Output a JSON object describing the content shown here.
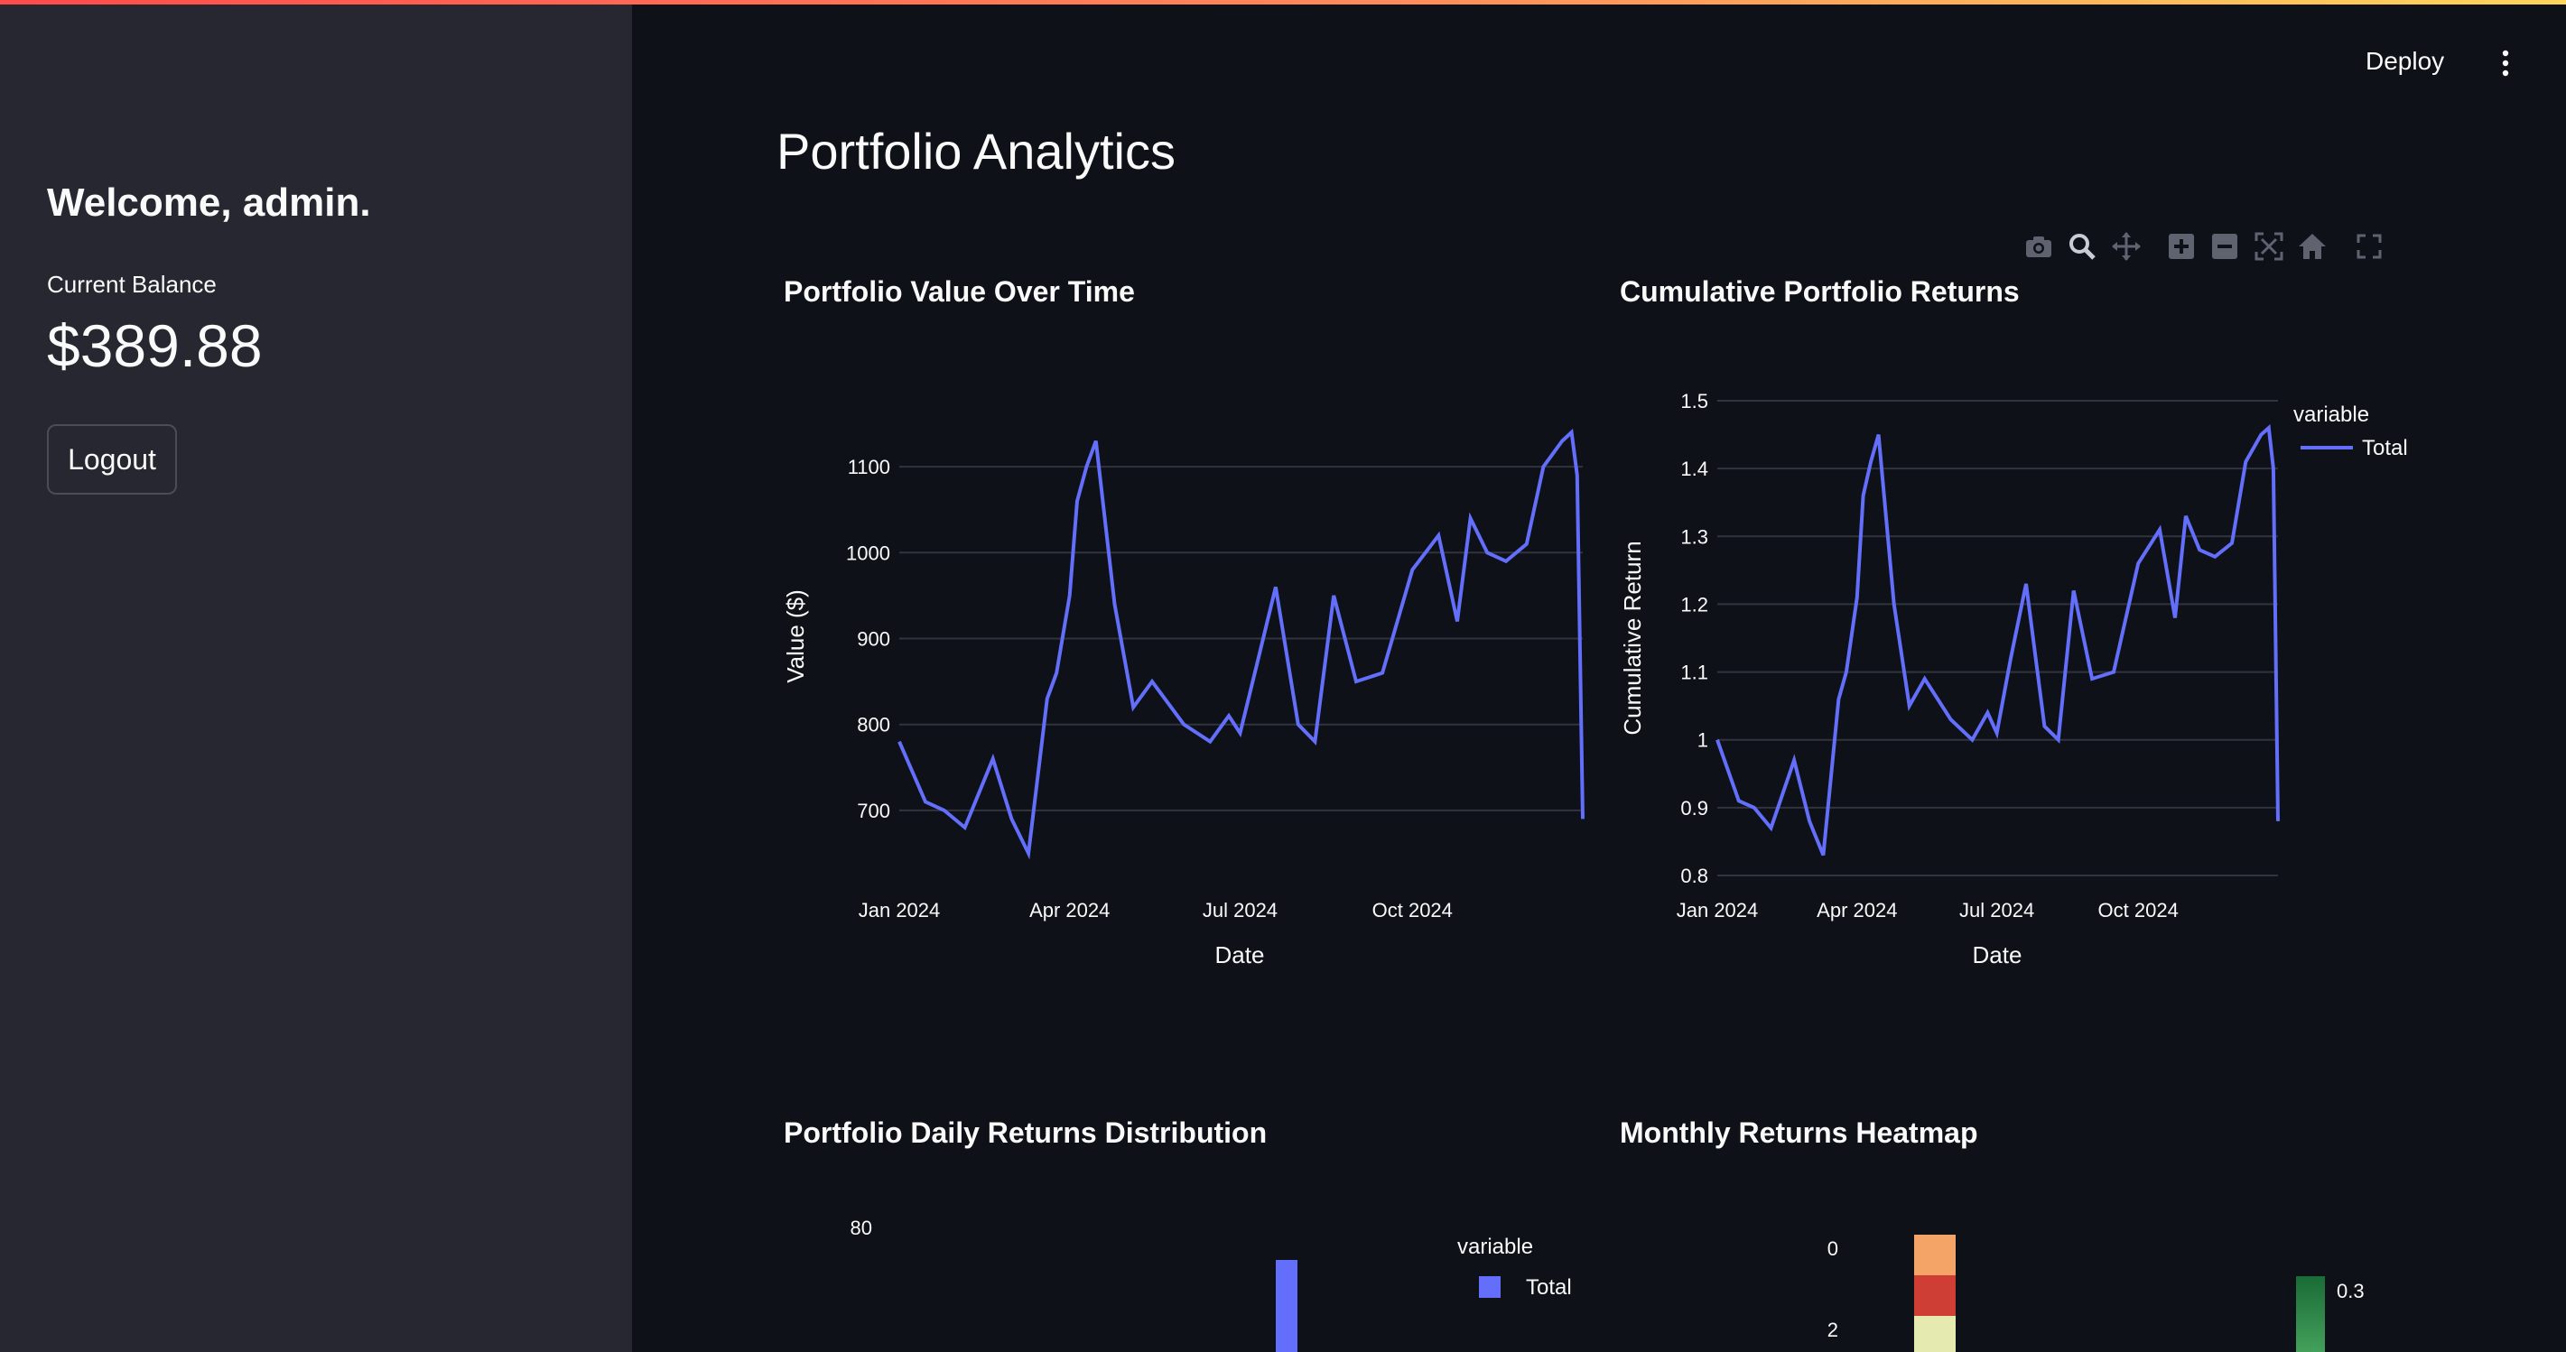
{
  "sidebar": {
    "welcome": "Welcome, admin.",
    "balance_label": "Current Balance",
    "balance_value": "$389.88",
    "logout_label": "Logout"
  },
  "header": {
    "deploy_label": "Deploy",
    "menu_icon": "vertical-ellipsis-icon"
  },
  "page": {
    "title": "Portfolio Analytics"
  },
  "modebar": {
    "icons": [
      "camera-icon",
      "zoom-icon",
      "pan-icon",
      "zoom-in-icon",
      "zoom-out-icon",
      "autoscale-icon",
      "reset-axes-icon",
      "fullscreen-icon"
    ]
  },
  "colors": {
    "accent": "#636efa",
    "background": "#0e1117",
    "sidebar": "#262730",
    "grid": "#31333f"
  },
  "charts": {
    "value": {
      "title": "Portfolio Value Over Time"
    },
    "returns": {
      "title": "Cumulative Portfolio Returns"
    },
    "distribution": {
      "title": "Portfolio Daily Returns Distribution"
    },
    "heatmap": {
      "title": "Monthly Returns Heatmap"
    }
  },
  "chart_data": [
    {
      "type": "line",
      "title": "Portfolio Value Over Time",
      "xlabel": "Date",
      "ylabel": "Value ($)",
      "x_tick_labels": [
        "Jan 2024",
        "Apr 2024",
        "Jul 2024",
        "Oct 2024"
      ],
      "y_ticks": [
        700,
        800,
        900,
        1000,
        1100
      ],
      "ylim": [
        640,
        1160
      ],
      "series": [
        {
          "x": [
            "2024-01-01",
            "2024-01-15",
            "2024-01-25",
            "2024-02-05",
            "2024-02-20",
            "2024-03-01",
            "2024-03-10",
            "2024-03-20",
            "2024-03-25",
            "2024-04-01",
            "2024-04-05",
            "2024-04-10",
            "2024-04-15",
            "2024-04-25",
            "2024-05-05",
            "2024-05-15",
            "2024-06-01",
            "2024-06-15",
            "2024-06-25",
            "2024-07-01",
            "2024-07-10",
            "2024-07-20",
            "2024-08-01",
            "2024-08-10",
            "2024-08-20",
            "2024-09-01",
            "2024-09-15",
            "2024-10-01",
            "2024-10-15",
            "2024-10-25",
            "2024-11-01",
            "2024-11-10",
            "2024-11-20",
            "2024-12-01",
            "2024-12-10",
            "2024-12-20",
            "2024-12-25",
            "2024-12-28",
            "2024-12-31"
          ],
          "values": [
            780,
            710,
            700,
            680,
            760,
            690,
            650,
            830,
            860,
            950,
            1060,
            1100,
            1130,
            940,
            820,
            850,
            800,
            780,
            810,
            790,
            870,
            960,
            800,
            780,
            950,
            850,
            860,
            980,
            1020,
            920,
            1040,
            1000,
            990,
            1010,
            1100,
            1130,
            1140,
            1090,
            690
          ]
        }
      ]
    },
    {
      "type": "line",
      "title": "Cumulative Portfolio Returns",
      "xlabel": "Date",
      "ylabel": "Cumulative Return",
      "legend_title": "variable",
      "legend_position": "top-right",
      "x_tick_labels": [
        "Jan 2024",
        "Apr 2024",
        "Jul 2024",
        "Oct 2024"
      ],
      "y_tick_labels": [
        "0.8",
        "0.9",
        "1",
        "1.1",
        "1.2",
        "1.3",
        "1.4",
        "1.5"
      ],
      "ylim": [
        0.8,
        1.5
      ],
      "series": [
        {
          "name": "Total",
          "x": [
            "2024-01-01",
            "2024-01-15",
            "2024-01-25",
            "2024-02-05",
            "2024-02-20",
            "2024-03-01",
            "2024-03-10",
            "2024-03-20",
            "2024-03-25",
            "2024-04-01",
            "2024-04-05",
            "2024-04-10",
            "2024-04-15",
            "2024-04-25",
            "2024-05-05",
            "2024-05-15",
            "2024-06-01",
            "2024-06-15",
            "2024-06-25",
            "2024-07-01",
            "2024-07-10",
            "2024-07-20",
            "2024-08-01",
            "2024-08-10",
            "2024-08-20",
            "2024-09-01",
            "2024-09-15",
            "2024-10-01",
            "2024-10-15",
            "2024-10-25",
            "2024-11-01",
            "2024-11-10",
            "2024-11-20",
            "2024-12-01",
            "2024-12-10",
            "2024-12-20",
            "2024-12-25",
            "2024-12-28",
            "2024-12-31"
          ],
          "values": [
            1.0,
            0.91,
            0.9,
            0.87,
            0.97,
            0.88,
            0.83,
            1.06,
            1.1,
            1.21,
            1.36,
            1.41,
            1.45,
            1.2,
            1.05,
            1.09,
            1.03,
            1.0,
            1.04,
            1.01,
            1.12,
            1.23,
            1.02,
            1.0,
            1.22,
            1.09,
            1.1,
            1.26,
            1.31,
            1.18,
            1.33,
            1.28,
            1.27,
            1.29,
            1.41,
            1.45,
            1.46,
            1.4,
            0.88
          ]
        }
      ]
    },
    {
      "type": "bar",
      "title": "Portfolio Daily Returns Distribution",
      "legend_title": "variable",
      "y_tick_labels": [
        "80"
      ],
      "series": [
        {
          "name": "Total"
        }
      ]
    },
    {
      "type": "heatmap",
      "title": "Monthly Returns Heatmap",
      "y_tick_labels": [
        "0",
        "2"
      ],
      "colorbar_tick_labels": [
        "0.3"
      ]
    }
  ]
}
